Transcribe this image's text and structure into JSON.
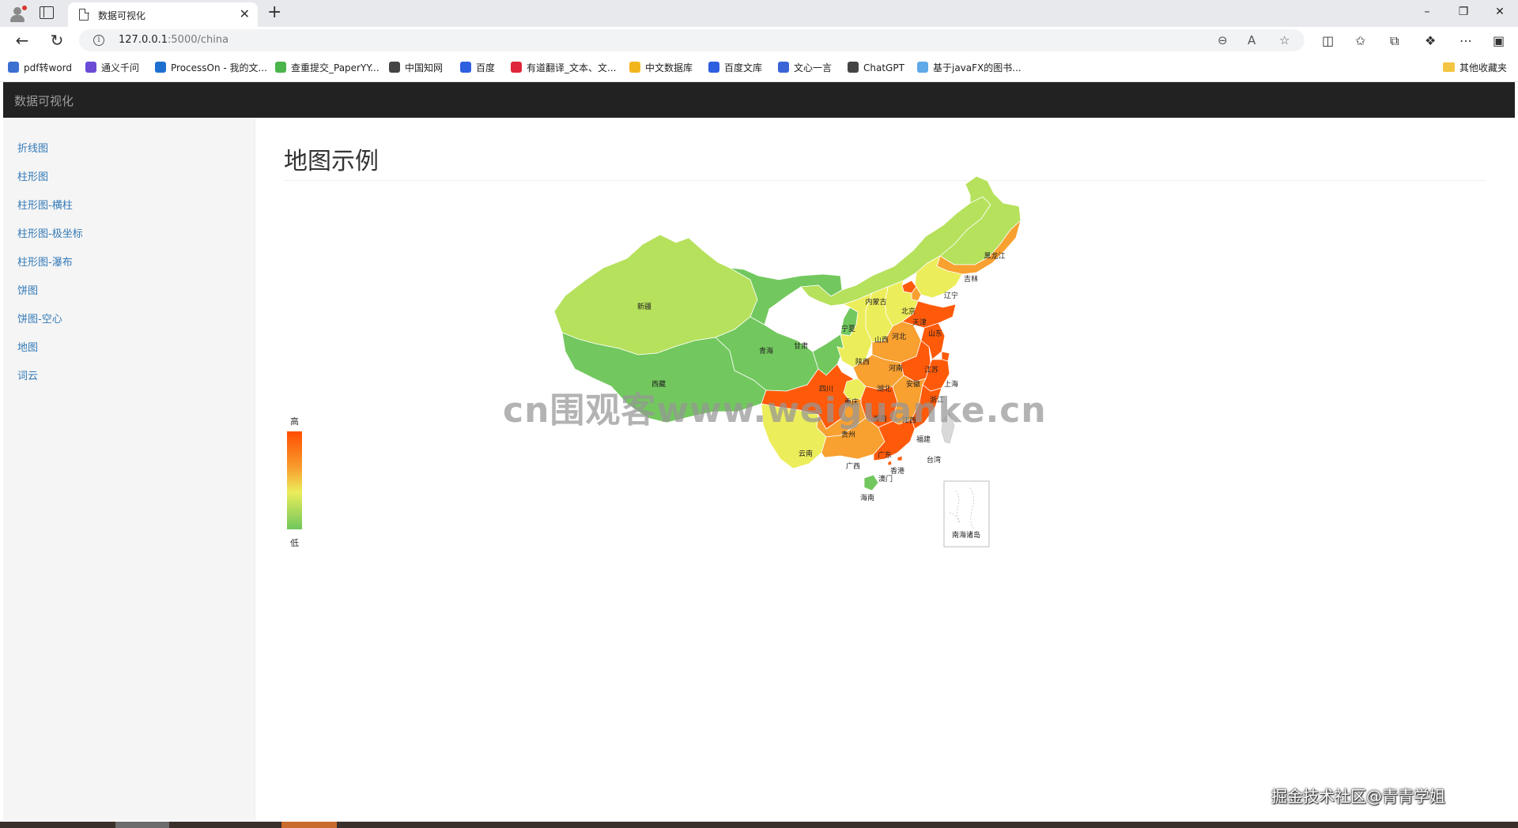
{
  "browser": {
    "tab_title": "数据可视化",
    "url_host": "127.0.0.1",
    "url_path": ":5000/china",
    "bookmarks": [
      {
        "label": "pdf转word",
        "color": "#3b6fd0"
      },
      {
        "label": "通义千问",
        "color": "#6a4bd6"
      },
      {
        "label": "ProcessOn - 我的文...",
        "color": "#1f6fd1"
      },
      {
        "label": "查重提交_PaperYY...",
        "color": "#4bb44a"
      },
      {
        "label": "中国知网",
        "color": "#444444"
      },
      {
        "label": "百度",
        "color": "#2e5fe0"
      },
      {
        "label": "有道翻译_文本、文...",
        "color": "#e0263a"
      },
      {
        "label": "中文数据库",
        "color": "#f2b51e"
      },
      {
        "label": "百度文库",
        "color": "#2e5fe0"
      },
      {
        "label": "文心一言",
        "color": "#3a63d8"
      },
      {
        "label": "ChatGPT",
        "color": "#444444"
      },
      {
        "label": "基于javaFX的图书...",
        "color": "#60a8e8"
      }
    ],
    "other_bookmarks": "其他收藏夹"
  },
  "app": {
    "brand": "数据可视化",
    "nav": [
      "折线图",
      "柱形图",
      "柱形图-横柱",
      "柱形图-极坐标",
      "柱形图-瀑布",
      "饼图",
      "饼图-空心",
      "地图",
      "词云"
    ],
    "page_title": "地图示例"
  },
  "map": {
    "legend_high": "高",
    "legend_low": "低",
    "nanhai_label": "南海诸岛",
    "colors": {
      "high": "#ff5a0a",
      "mid_high": "#f8a030",
      "mid": "#eced5a",
      "mid_low": "#b6e15c",
      "low": "#72c85e"
    },
    "provinces": [
      {
        "name": "新疆",
        "level": "mid_low"
      },
      {
        "name": "西藏",
        "level": "low"
      },
      {
        "name": "青海",
        "level": "low"
      },
      {
        "name": "甘肃",
        "level": "low"
      },
      {
        "name": "内蒙古",
        "level": "mid_low"
      },
      {
        "name": "黑龙江",
        "level": "mid_low"
      },
      {
        "name": "吉林",
        "level": "mid_high"
      },
      {
        "name": "辽宁",
        "level": "mid"
      },
      {
        "name": "北京",
        "level": "high"
      },
      {
        "name": "天津",
        "level": "mid_high"
      },
      {
        "name": "河北",
        "level": "mid"
      },
      {
        "name": "山西",
        "level": "mid"
      },
      {
        "name": "宁夏",
        "level": "low"
      },
      {
        "name": "陕西",
        "level": "mid"
      },
      {
        "name": "河南",
        "level": "mid_high"
      },
      {
        "name": "山东",
        "level": "high"
      },
      {
        "name": "四川",
        "level": "high"
      },
      {
        "name": "重庆",
        "level": "mid"
      },
      {
        "name": "湖北",
        "level": "mid_high"
      },
      {
        "name": "安徽",
        "level": "high"
      },
      {
        "name": "江苏",
        "level": "high"
      },
      {
        "name": "上海",
        "level": "high"
      },
      {
        "name": "浙江",
        "level": "high"
      },
      {
        "name": "湖南",
        "level": "high"
      },
      {
        "name": "江西",
        "level": "mid_high"
      },
      {
        "name": "福建",
        "level": "high"
      },
      {
        "name": "贵州",
        "level": "mid_high"
      },
      {
        "name": "云南",
        "level": "mid"
      },
      {
        "name": "广西",
        "level": "mid_high"
      },
      {
        "name": "广东",
        "level": "high"
      },
      {
        "name": "香港",
        "level": "high"
      },
      {
        "name": "澳门",
        "level": "high"
      },
      {
        "name": "台湾",
        "level": "none"
      },
      {
        "name": "海南",
        "level": "low"
      }
    ]
  },
  "overlays": {
    "watermark": "cn围观客www.weiguanke.cn",
    "credit": "掘金技术社区@青青学姐"
  }
}
